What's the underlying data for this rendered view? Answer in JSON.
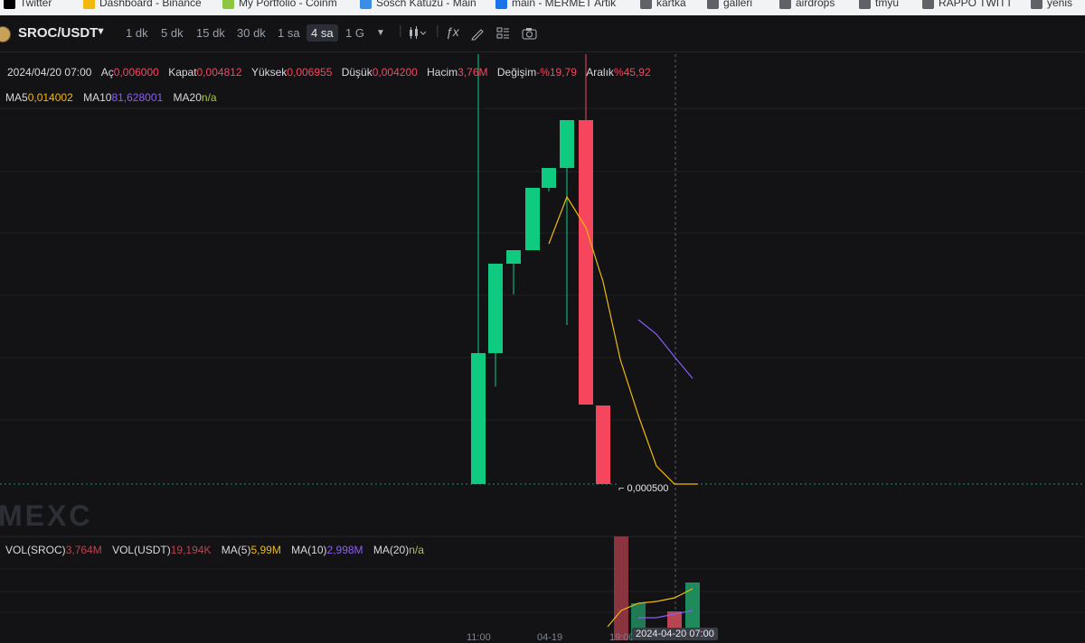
{
  "bookmarks": [
    {
      "label": "Twitter",
      "icon": "x-logo-icon",
      "color": "#000000"
    },
    {
      "label": "Dashboard - Binance",
      "icon": "binance-icon",
      "color": "#f0b90b"
    },
    {
      "label": "My Portfolio - Coinm",
      "icon": "coin-icon",
      "color": "#8dc63f"
    },
    {
      "label": "Sosch Katuzu - Main",
      "icon": "chart-icon",
      "color": "#3a8ee6"
    },
    {
      "label": "main - MERMET Artik",
      "icon": "folder-icon",
      "color": "#1a73e8"
    },
    {
      "label": "kartka",
      "icon": "folder-icon",
      "color": "#5f6368"
    },
    {
      "label": "galleri",
      "icon": "folder-icon",
      "color": "#5f6368"
    },
    {
      "label": "airdrops",
      "icon": "folder-icon",
      "color": "#5f6368"
    },
    {
      "label": "tmyu",
      "icon": "folder-icon",
      "color": "#5f6368"
    },
    {
      "label": "RAPPO TWITT",
      "icon": "folder-icon",
      "color": "#5f6368"
    },
    {
      "label": "yenis",
      "icon": "folder-icon",
      "color": "#5f6368"
    }
  ],
  "pair": "SROC/USDT",
  "timeframes": [
    "1 dk",
    "5 dk",
    "15 dk",
    "30 dk",
    "1 sa",
    "4 sa",
    "1 G"
  ],
  "active_timeframe": "4 sa",
  "toolbar_icons": [
    "chevron-down-icon",
    "candlestick-type-icon",
    "indicator-fx-icon",
    "draw-pen-icon",
    "layout-grid-icon",
    "camera-icon"
  ],
  "ohlc": {
    "date": "2024/04/20 07:00",
    "open_label": "Aç",
    "open": "0,006000",
    "close_label": "Kapat",
    "close": "0,004812",
    "high_label": "Yüksek",
    "high": "0,006955",
    "low_label": "Düşük",
    "low": "0,004200",
    "volume_label": "Hacim",
    "volume": "3,76M",
    "change_label": "Değişim",
    "change": "-%19,79",
    "range_label": "Aralık",
    "range": "%45,92"
  },
  "ma": {
    "ma5_label": "MA5",
    "ma5": "0,014002",
    "ma10_label": "MA10",
    "ma10": "81,628001",
    "ma20_label": "MA20",
    "ma20": "n/a"
  },
  "volume_panel": {
    "vol_sroc_label": "VOL(SROC)",
    "vol_sroc": "3,764M",
    "vol_usdt_label": "VOL(USDT)",
    "vol_usdt": "19,194K",
    "ma5_label": "MA(5)",
    "ma5": "5,99M",
    "ma10_label": "MA(10)",
    "ma10": "2,998M",
    "ma20_label": "MA(20)",
    "ma20": "n/a"
  },
  "watermark": "MEXC",
  "last_price_tag": "0,000500",
  "crosshair_date": "2024-04-20 07:00",
  "x_ticks": [
    "11:00",
    "04-19",
    "19:00"
  ],
  "colors": {
    "up": "#0ecb81",
    "down": "#f6465d",
    "ma5": "#f0b90b",
    "ma10": "#8c5cf6",
    "ma20": "#a6c94a",
    "background": "#131316"
  }
}
